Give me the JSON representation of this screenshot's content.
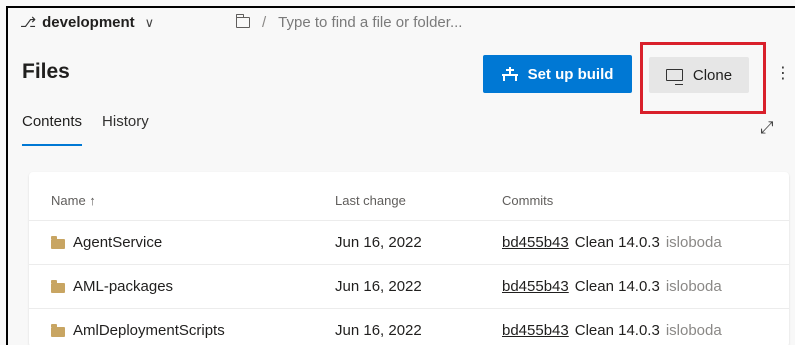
{
  "branch": {
    "name": "development"
  },
  "path": {
    "placeholder": "Type to find a file or folder...",
    "separator": "/"
  },
  "page": {
    "title": "Files"
  },
  "toolbar": {
    "setup_build_label": "Set up build",
    "clone_label": "Clone",
    "more_label": "⋮"
  },
  "tabs": [
    {
      "label": "Contents",
      "active": true
    },
    {
      "label": "History",
      "active": false
    }
  ],
  "table": {
    "headers": {
      "name": "Name ↑",
      "last_change": "Last change",
      "commits": "Commits"
    },
    "rows": [
      {
        "name": "AgentService",
        "last_change": "Jun 16, 2022",
        "hash": "bd455b43",
        "message": "Clean 14.0.3",
        "author": "isloboda"
      },
      {
        "name": "AML-packages",
        "last_change": "Jun 16, 2022",
        "hash": "bd455b43",
        "message": "Clean 14.0.3",
        "author": "isloboda"
      },
      {
        "name": "AmlDeploymentScripts",
        "last_change": "Jun 16, 2022",
        "hash": "bd455b43",
        "message": "Clean 14.0.3",
        "author": "isloboda"
      }
    ]
  },
  "icons": {
    "branch": "git-branch-icon",
    "folder_outline": "folder-outline-icon",
    "build": "build-pipeline-icon",
    "clone": "monitor-icon",
    "more": "more-vertical-icon",
    "expand": "expand-icon",
    "folder": "folder-icon"
  },
  "colors": {
    "primary": "#0078d4",
    "highlight_box": "#d9202b",
    "folder": "#c8a562"
  }
}
